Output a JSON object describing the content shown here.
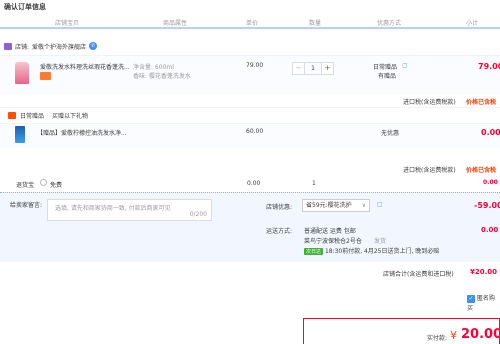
{
  "page_title": "确认订单信息",
  "columns": [
    "店铺宝贝",
    "商品属性",
    "单价",
    "数量",
    "优惠方式",
    "小计"
  ],
  "shop": {
    "label": "店铺:",
    "name": "爱敬个护海外旗舰店",
    "ww_icon": "wangwang-icon"
  },
  "item1": {
    "name": "爱敬洗发水料理洗丝瑕花香蓬洗...",
    "attr1": "净含量: 600ml",
    "attr2": "香味: 樱花香蓬洗发水",
    "price": "79.00",
    "qty": "1",
    "promo1": "日常赠品",
    "promo2": "有赠品",
    "subtotal": "79.00",
    "tax_note": "进口税(含运费税款)",
    "tax_value": "价格已含税"
  },
  "gift": {
    "head1": "日常赠品",
    "head2": "买赠以下礼物",
    "name": "【赠品】爱敬柠檬控油洗发水净...",
    "price": "60.00",
    "promo": "无优惠",
    "subtotal": "0.00",
    "tax_note": "进口税(含运费税款)",
    "tax_value": "价格已含税"
  },
  "insurance": {
    "label": "退货宝",
    "option": "免费",
    "price": "0.00",
    "qty": "1",
    "subtotal": "0.00"
  },
  "message": {
    "label": "给卖家留言:",
    "placeholder": "选填, 请先和商家协商一致, 付款后商家可见",
    "counter": "0/200"
  },
  "coupon": {
    "label": "店铺优惠:",
    "selected": "省59元:樱花洗护",
    "value": "-59.00"
  },
  "delivery": {
    "label": "运送方式:",
    "line1": "普通配送 运费 包邮",
    "line2": "菜鸟宁波保税仓2号仓",
    "line2b": "发货",
    "tag": "次日达",
    "line3": "18:30前付款, 4月25日送货上门, 晚到必赔",
    "value": "0.00"
  },
  "shop_total": {
    "label": "店铺合计(含运费和进口税)",
    "value": "¥20.00"
  },
  "anonymous": {
    "label": "匿名购买"
  },
  "payment": {
    "label": "实付款:",
    "currency": "¥",
    "amount": "20.00"
  }
}
